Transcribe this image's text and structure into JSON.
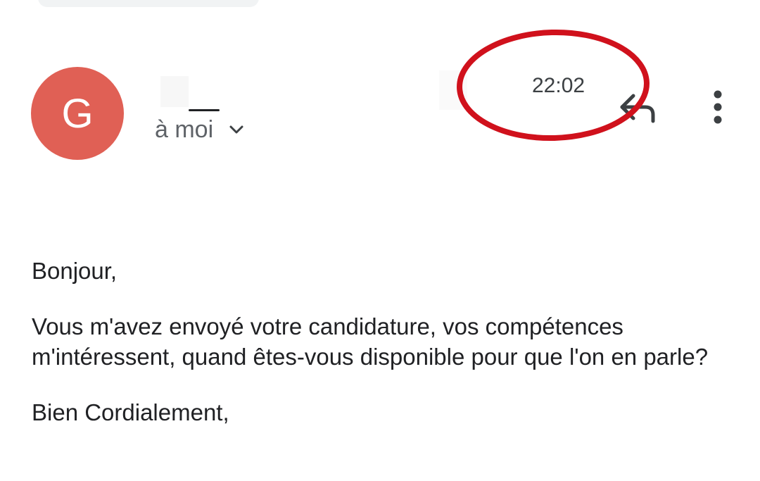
{
  "header": {
    "avatar_letter": "G",
    "avatar_color": "#e06055",
    "recipient_label": "à moi",
    "time": "22:02",
    "annotation_color": "#d0111c"
  },
  "icons": {
    "recipient_toggle": "chevron-down-icon",
    "reply": "reply-icon",
    "more": "more-vert-icon"
  },
  "body": {
    "greeting": "Bonjour,",
    "message": "Vous m'avez envoyé votre candidature, vos compétences m'intéressent, quand êtes-vous disponible pour que l'on en parle?",
    "closing": "Bien Cordialement,"
  }
}
